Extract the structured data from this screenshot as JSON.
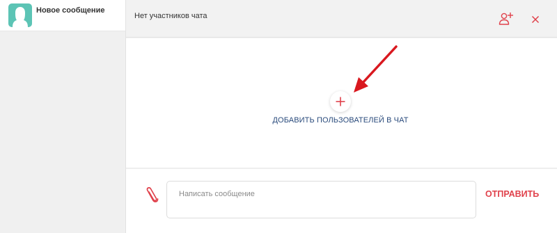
{
  "sidebar": {
    "items": [
      {
        "title": "Новое сообщение",
        "avatar_icon": "user-silhouette-icon"
      }
    ]
  },
  "header": {
    "title": "Нет участников чата",
    "add_user_icon": "add-user-icon",
    "close_icon": "close-icon"
  },
  "main": {
    "add_icon": "plus-icon",
    "add_label": "ДОБАВИТЬ ПОЛЬЗОВАТЕЛЕЙ В ЧАТ"
  },
  "composer": {
    "attach_icon": "paperclip-icon",
    "input_placeholder": "Написать сообщение",
    "input_value": "",
    "send_label": "ОТПРАВИТЬ"
  },
  "colors": {
    "accent_red": "#e0414b",
    "link_blue": "#2a4b7c",
    "avatar_teal": "#5cc4b5",
    "arrow_red": "#d9181f"
  }
}
